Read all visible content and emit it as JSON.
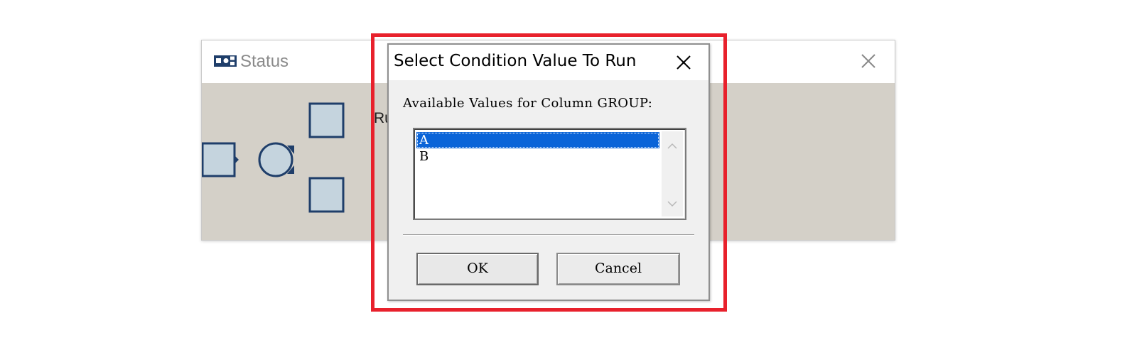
{
  "status_window": {
    "title": "Status",
    "run_text": "Ru"
  },
  "dialog": {
    "title": "Select Condition Value To Run",
    "available_label": "Available Values for Column GROUP:",
    "values": [
      {
        "label": "A",
        "selected": true
      },
      {
        "label": "B",
        "selected": false
      }
    ],
    "ok_label": "OK",
    "cancel_label": "Cancel"
  },
  "icons": {
    "status_app": "workflow-icon",
    "status_close": "close-icon",
    "dialog_close": "close-icon",
    "scroll_up": "chevron-up-icon",
    "scroll_down": "chevron-down-icon"
  },
  "colors": {
    "highlight": "#e8212c",
    "selection": "#0a64d8",
    "status_body": "#d4d0c8",
    "node_fill": "#c5d4de",
    "node_stroke": "#1f3e6a"
  }
}
